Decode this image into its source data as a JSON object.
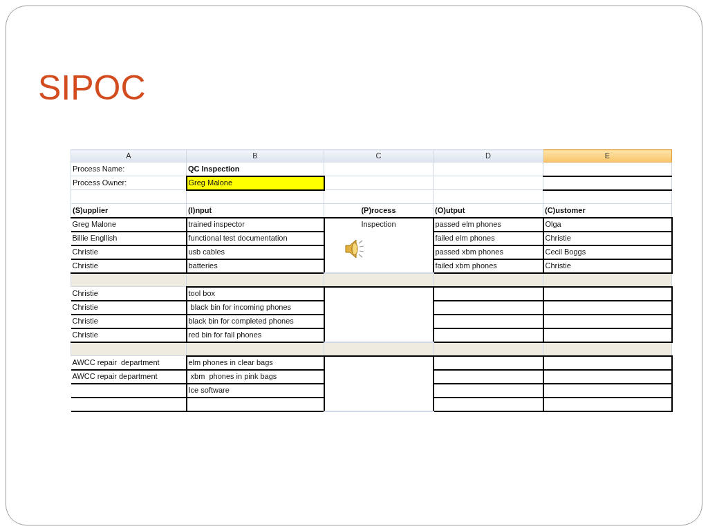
{
  "slide": {
    "title": "SIPOC"
  },
  "sheet": {
    "columns": [
      {
        "label": "A",
        "selected": false
      },
      {
        "label": "B",
        "selected": false
      },
      {
        "label": "C",
        "selected": false
      },
      {
        "label": "D",
        "selected": false
      },
      {
        "label": "E",
        "selected": true
      }
    ],
    "process_name": {
      "label": "Process Name:",
      "value": "QC Inspection"
    },
    "process_owner": {
      "label": "Process Owner:",
      "value": "Greg Malone",
      "highlighted": true
    },
    "headers": {
      "supplier": "(S)upplier",
      "input": "(I)nput",
      "process": "(P)rocess",
      "output": "(O)utput",
      "customer": "(C)ustomer"
    },
    "sections": [
      {
        "process": "Inspection",
        "audio_icon": true,
        "rows": [
          {
            "supplier": "Greg Malone",
            "input": "trained inspector",
            "output": "passed elm phones",
            "customer": "Olga"
          },
          {
            "supplier": "Billie Engllish",
            "input": "functional test documentation",
            "output": "failed elm phones",
            "customer": "Christie"
          },
          {
            "supplier": "Christie",
            "input": "usb cables",
            "output": "passed xbm phones",
            "customer": "Cecil Boggs"
          },
          {
            "supplier": "Christie",
            "input": "batteries",
            "output": "failed xbm phones",
            "customer": "Christie"
          }
        ]
      },
      {
        "audio_icon": false,
        "rows": [
          {
            "supplier": "Christie",
            "input": "tool box"
          },
          {
            "supplier": "Christie",
            "input": " black bin for incoming phones"
          },
          {
            "supplier": "Christie",
            "input": "black bin for completed phones"
          },
          {
            "supplier": "Christie",
            "input": "red bin for fail phones"
          }
        ]
      },
      {
        "audio_icon": false,
        "rows": [
          {
            "supplier": "AWCC repair  department",
            "input": "elm phones in clear bags"
          },
          {
            "supplier": "AWCC repair department",
            "input": " xbm  phones in pink bags"
          },
          {
            "input": "Ice software"
          },
          {}
        ]
      }
    ]
  }
}
